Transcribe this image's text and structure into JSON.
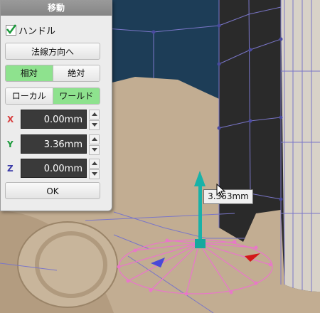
{
  "dialog": {
    "title": "移動",
    "handle_label": "ハンドル",
    "handle_checked": true,
    "normal_dir_button": "法線方向へ",
    "mode_segment": {
      "options": [
        "相対",
        "絶対"
      ],
      "selected": "相対"
    },
    "space_segment": {
      "options": [
        "ローカル",
        "ワールド"
      ],
      "selected": "ワールド"
    },
    "x": {
      "label": "X",
      "value": "0.00mm",
      "color": "#d84040"
    },
    "y": {
      "label": "Y",
      "value": "3.36mm",
      "color": "#1a9a3a"
    },
    "z": {
      "label": "Z",
      "value": "0.00mm",
      "color": "#3a3aa8"
    },
    "ok_button": "OK"
  },
  "viewport": {
    "tooltip": "3.363mm",
    "colors": {
      "sky": "#1d3d57",
      "ground": "#c2ad92",
      "pillar": "#2a2a2a",
      "wire": "#7a76c8",
      "handle_ring": "#e878c8",
      "arrow": "#18b2a8"
    },
    "icons": [
      "gizmo-up-arrow-icon",
      "gizmo-red-cone-icon",
      "gizmo-blue-cone-icon",
      "mouse-cursor-icon"
    ]
  }
}
